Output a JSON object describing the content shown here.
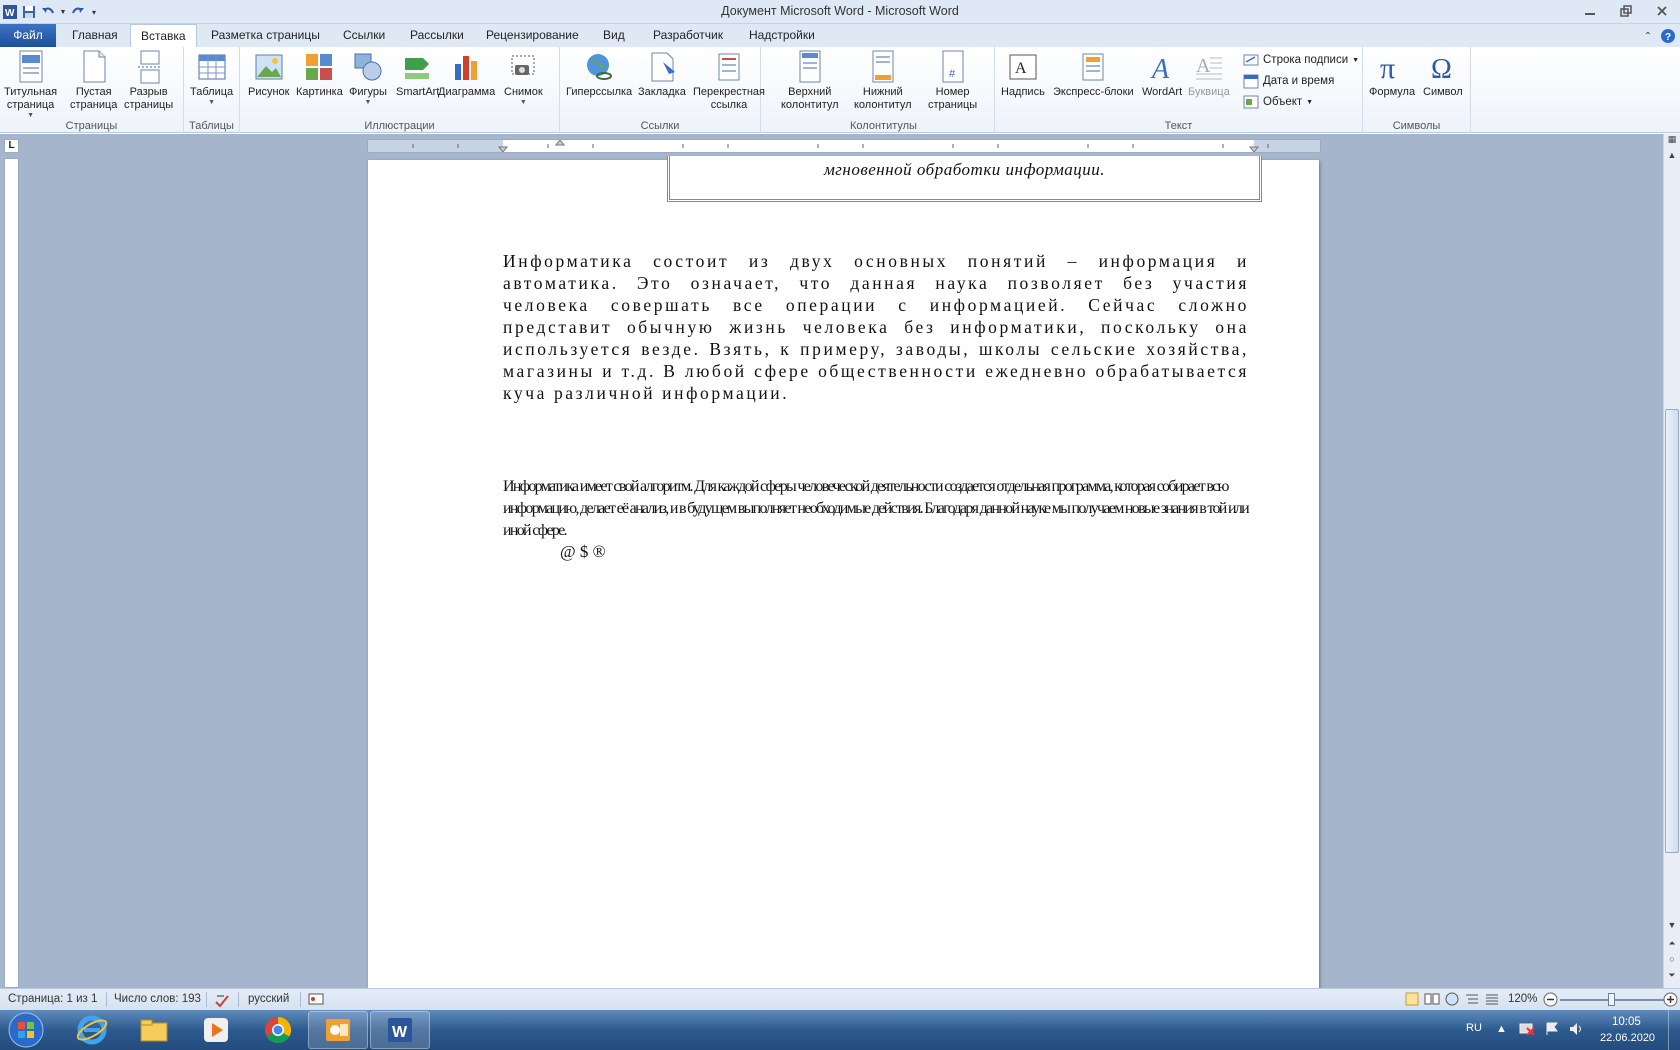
{
  "window": {
    "title": "Документ Microsoft Word  -  Microsoft Word"
  },
  "tabs": {
    "file": "Файл",
    "home": "Главная",
    "insert": "Вставка",
    "layout": "Разметка страницы",
    "references": "Ссылки",
    "mailings": "Рассылки",
    "review": "Рецензирование",
    "view": "Вид",
    "developer": "Разработчик",
    "addins": "Надстройки"
  },
  "ribbon": {
    "pages": {
      "label": "Страницы",
      "cover_1": "Титульная",
      "cover_2": "страница",
      "blank_1": "Пустая",
      "blank_2": "страница",
      "break_1": "Разрыв",
      "break_2": "страницы"
    },
    "tables": {
      "label": "Таблицы",
      "table": "Таблица"
    },
    "illustrations": {
      "label": "Иллюстрации",
      "picture": "Рисунок",
      "clipart": "Картинка",
      "shapes": "Фигуры",
      "smartart": "SmartArt",
      "chart": "Диаграмма",
      "screenshot": "Снимок"
    },
    "links": {
      "label": "Ссылки",
      "hyperlink": "Гиперссылка",
      "bookmark": "Закладка",
      "crossref_1": "Перекрестная",
      "crossref_2": "ссылка"
    },
    "header_footer": {
      "label": "Колонтитулы",
      "header_1": "Верхний",
      "header_2": "колонтитул",
      "footer_1": "Нижний",
      "footer_2": "колонтитул",
      "pagenum_1": "Номер",
      "pagenum_2": "страницы"
    },
    "text": {
      "label": "Текст",
      "textbox": "Надпись",
      "quickparts": "Экспресс-блоки",
      "wordart": "WordArt",
      "dropcap": "Буквица",
      "signature": "Строка подписи",
      "datetime": "Дата и время",
      "object": "Объект"
    },
    "symbols": {
      "label": "Символы",
      "equation": "Формула",
      "symbol": "Символ"
    }
  },
  "document": {
    "textbox_text": "мгновенной обработки информации.",
    "para1": "Информатика состоит из двух основных понятий – информация и автоматика. Это означает, что данная наука позволяет без участия человека совершать все операции с информацией. Сейчас сложно представит обычную жизнь человека без информатики, поскольку она используется везде. Взять, к примеру, заводы, школы сельские хозяйства, магазины и т.д. В любой сфере общественности ежедневно обрабатывается куча различной информации.",
    "para2": "Информатика имеет свой алгоритм. Для каждой сферы человеческой деятельности создается отдельная программа, которая собирает всю информацию, делает её анализ, и в будущем выполняет необходимые действия. Благодаря данной науке мы получаем новые знания в той или иной сфере.",
    "symbols": "@ $ ®"
  },
  "statusbar": {
    "page": "Страница: 1 из 1",
    "words": "Число слов: 193",
    "language": "русский",
    "zoom": "120%",
    "zoom_percent": 120
  },
  "taskbar": {
    "lang": "RU",
    "time": "10:05",
    "date": "22.06.2020"
  },
  "colors": {
    "file_tab": "#2b579a",
    "workspace": "#a5b5cc",
    "taskbar": "#2d5a8e"
  }
}
